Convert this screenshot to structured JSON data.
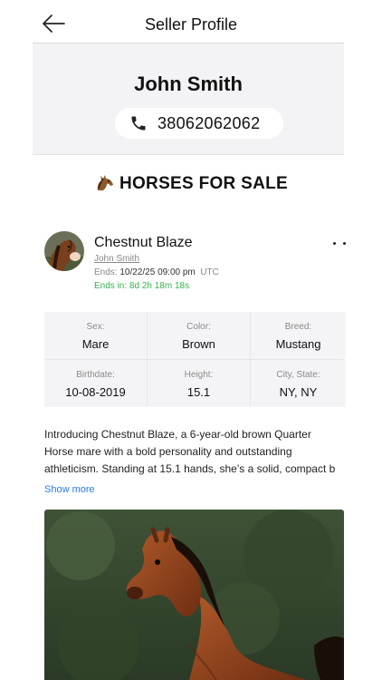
{
  "header": {
    "title": "Seller Profile",
    "back_icon": "arrow-left-icon"
  },
  "seller": {
    "name": "John Smith",
    "phone": "38062062062",
    "phone_icon": "phone-icon"
  },
  "section": {
    "title": "HORSES FOR SALE",
    "icon": "horse-emoji-icon"
  },
  "listing": {
    "title": "Chestnut Blaze",
    "seller": "John Smith",
    "ends_label": "Ends:",
    "ends_date": "10/22/25 09:00 pm",
    "ends_tz": "UTC",
    "ends_in": "Ends in: 8d 2h 18m 18s",
    "specs": [
      {
        "label": "Sex:",
        "value": "Mare"
      },
      {
        "label": "Color:",
        "value": "Brown"
      },
      {
        "label": "Breed:",
        "value": "Mustang"
      },
      {
        "label": "Birthdate:",
        "value": "10-08-2019"
      },
      {
        "label": "Height:",
        "value": "15.1"
      },
      {
        "label": "City, State:",
        "value": "NY, NY"
      }
    ],
    "description_lines": [
      "Introducing Chestnut Blaze, a 6-year-old brown Quarter",
      "Horse mare with a bold personality and outstanding",
      "athleticism. Standing at 15.1 hands, she’s a solid, compact b"
    ],
    "show_more": "Show more"
  },
  "colors": {
    "accent_link": "#2d7be0",
    "countdown_green": "#37b24d",
    "card_bg": "#f3f3f5"
  }
}
